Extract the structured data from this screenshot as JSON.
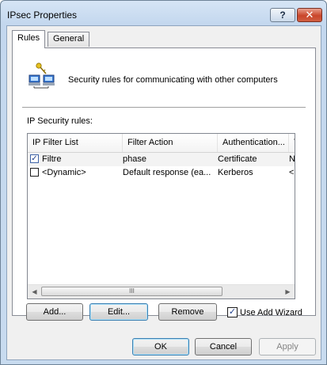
{
  "window": {
    "title": "IPsec Properties",
    "help_glyph": "?",
    "close_glyph": "✕"
  },
  "tabs": [
    {
      "label": "Rules",
      "active": true
    },
    {
      "label": "General",
      "active": false
    }
  ],
  "header": {
    "icon": "network-computers-key-icon",
    "description": "Security rules for communicating with other computers"
  },
  "rules": {
    "label": "IP Security rules:",
    "columns": [
      "IP Filter List",
      "Filter Action",
      "Authentication...",
      "Tu"
    ],
    "rows": [
      {
        "checked": true,
        "cells": [
          "Filtre",
          "phase",
          "Certificate",
          "No"
        ]
      },
      {
        "checked": false,
        "cells": [
          "<Dynamic>",
          "Default response (ea...",
          "Kerberos",
          "<N"
        ]
      }
    ],
    "scrollbar": {
      "left_arrow": "◀",
      "right_arrow": "▶",
      "thumb_grip": "III"
    }
  },
  "buttons": {
    "add": "Add...",
    "edit": "Edit...",
    "remove": "Remove",
    "ok": "OK",
    "cancel": "Cancel",
    "apply": "Apply"
  },
  "use_add_wizard": {
    "label": "Use Add Wizard",
    "checked": true
  },
  "check_glyph": "✓",
  "colors": {
    "title_bar": "#c3d7ee",
    "close_button": "#c9452a",
    "focus_border": "#3c7fb1"
  }
}
